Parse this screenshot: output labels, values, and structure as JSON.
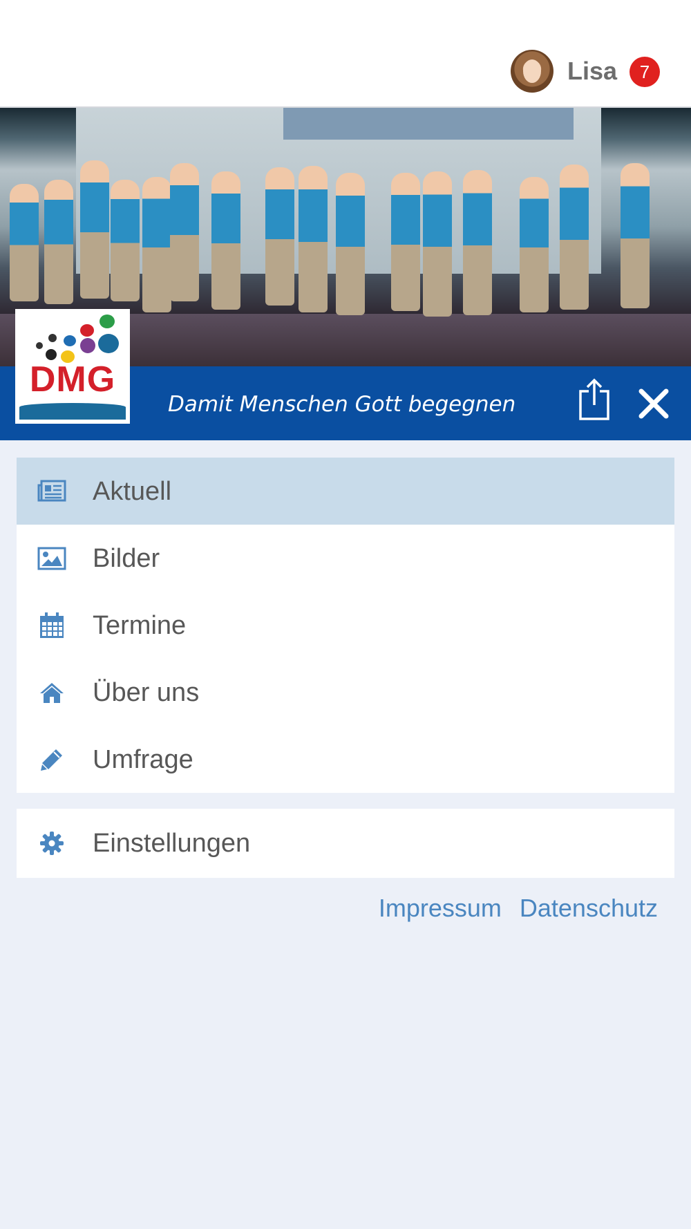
{
  "header": {
    "user_name": "Lisa",
    "notification_count": "7"
  },
  "brand": {
    "logo_text": "DMG",
    "tagline": "Damit Menschen Gott begegnen"
  },
  "colors": {
    "brand_blue": "#0a4fa1",
    "active_bg": "#c8dbea",
    "icon_blue": "#4a86c0",
    "badge_red": "#e0211f",
    "page_bg": "#ecf0f8"
  },
  "menu": {
    "items": [
      {
        "label": "Aktuell",
        "icon": "newspaper-icon",
        "active": true
      },
      {
        "label": "Bilder",
        "icon": "image-icon",
        "active": false
      },
      {
        "label": "Termine",
        "icon": "calendar-icon",
        "active": false
      },
      {
        "label": "Über uns",
        "icon": "home-icon",
        "active": false
      },
      {
        "label": "Umfrage",
        "icon": "pencil-icon",
        "active": false
      }
    ],
    "settings": {
      "label": "Einstellungen",
      "icon": "gear-icon"
    }
  },
  "footer": {
    "links": [
      "Impressum",
      "Datenschutz"
    ]
  }
}
